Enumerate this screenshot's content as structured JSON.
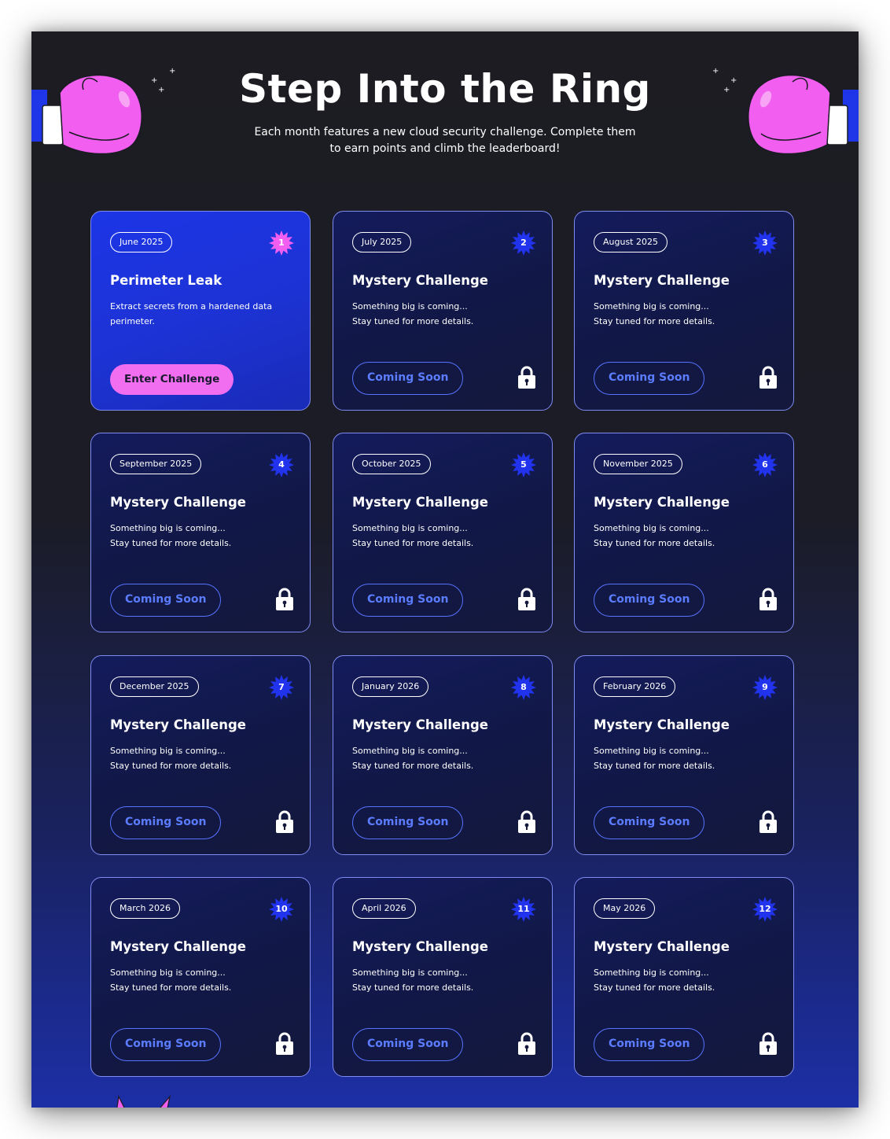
{
  "header": {
    "title": "Step Into the Ring",
    "subtitle": "Each month features a new cloud security challenge. Complete them to earn points and climb the leaderboard!"
  },
  "colors": {
    "accent_pink": "#f16ef0",
    "accent_blue": "#1f35e8",
    "card_border": "#7e8bf0",
    "coming_soon_text": "#5b7cff",
    "background_dark": "#1c1c22"
  },
  "cards": [
    {
      "date": "June 2025",
      "number": "1",
      "title": "Perimeter Leak",
      "desc_line1": "Extract secrets from a hardened data",
      "desc_line2": "perimeter.",
      "button": "Enter Challenge",
      "status": "active",
      "icon": "star-badge-icon"
    },
    {
      "date": "July 2025",
      "number": "2",
      "title": "Mystery Challenge",
      "desc_line1": "Something big is coming...",
      "desc_line2": "Stay tuned for more details.",
      "button": "Coming Soon",
      "status": "locked",
      "icon": "lock-icon"
    },
    {
      "date": "August 2025",
      "number": "3",
      "title": "Mystery Challenge",
      "desc_line1": "Something big is coming...",
      "desc_line2": "Stay tuned for more details.",
      "button": "Coming Soon",
      "status": "locked",
      "icon": "lock-icon"
    },
    {
      "date": "September 2025",
      "number": "4",
      "title": "Mystery Challenge",
      "desc_line1": "Something big is coming...",
      "desc_line2": "Stay tuned for more details.",
      "button": "Coming Soon",
      "status": "locked",
      "icon": "lock-icon"
    },
    {
      "date": "October 2025",
      "number": "5",
      "title": "Mystery Challenge",
      "desc_line1": "Something big is coming...",
      "desc_line2": "Stay tuned for more details.",
      "button": "Coming Soon",
      "status": "locked",
      "icon": "lock-icon"
    },
    {
      "date": "November 2025",
      "number": "6",
      "title": "Mystery Challenge",
      "desc_line1": "Something big is coming...",
      "desc_line2": "Stay tuned for more details.",
      "button": "Coming Soon",
      "status": "locked",
      "icon": "lock-icon"
    },
    {
      "date": "December 2025",
      "number": "7",
      "title": "Mystery Challenge",
      "desc_line1": "Something big is coming...",
      "desc_line2": "Stay tuned for more details.",
      "button": "Coming Soon",
      "status": "locked",
      "icon": "lock-icon"
    },
    {
      "date": "January 2026",
      "number": "8",
      "title": "Mystery Challenge",
      "desc_line1": "Something big is coming...",
      "desc_line2": "Stay tuned for more details.",
      "button": "Coming Soon",
      "status": "locked",
      "icon": "lock-icon"
    },
    {
      "date": "February 2026",
      "number": "9",
      "title": "Mystery Challenge",
      "desc_line1": "Something big is coming...",
      "desc_line2": "Stay tuned for more details.",
      "button": "Coming Soon",
      "status": "locked",
      "icon": "lock-icon"
    },
    {
      "date": "March 2026",
      "number": "10",
      "title": "Mystery Challenge",
      "desc_line1": "Something big is coming...",
      "desc_line2": "Stay tuned for more details.",
      "button": "Coming Soon",
      "status": "locked",
      "icon": "lock-icon"
    },
    {
      "date": "April 2026",
      "number": "11",
      "title": "Mystery Challenge",
      "desc_line1": "Something big is coming...",
      "desc_line2": "Stay tuned for more details.",
      "button": "Coming Soon",
      "status": "locked",
      "icon": "lock-icon"
    },
    {
      "date": "May 2026",
      "number": "12",
      "title": "Mystery Challenge",
      "desc_line1": "Something big is coming...",
      "desc_line2": "Stay tuned for more details.",
      "button": "Coming Soon",
      "status": "locked",
      "icon": "lock-icon"
    }
  ]
}
